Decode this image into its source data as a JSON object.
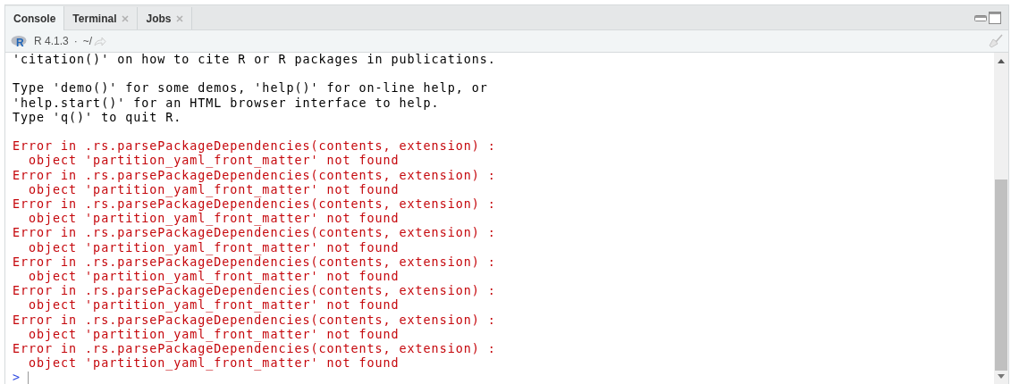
{
  "tabs": [
    {
      "label": "Console",
      "selected": true,
      "closable": false
    },
    {
      "label": "Terminal",
      "selected": false,
      "closable": true
    },
    {
      "label": "Jobs",
      "selected": false,
      "closable": true
    }
  ],
  "toolbar": {
    "logo": "R",
    "version": "R 4.1.3",
    "separator": "·",
    "path": "~/"
  },
  "console": {
    "lines": [
      {
        "kind": "output",
        "text": "'citation()' on how to cite R or R packages in publications."
      },
      {
        "kind": "blank"
      },
      {
        "kind": "output",
        "text": "Type 'demo()' for some demos, 'help()' for on-line help, or"
      },
      {
        "kind": "output",
        "text": "'help.start()' for an HTML browser interface to help."
      },
      {
        "kind": "output",
        "text": "Type 'q()' to quit R."
      },
      {
        "kind": "blank"
      },
      {
        "kind": "error",
        "text": "Error in .rs.parsePackageDependencies(contents, extension) :"
      },
      {
        "kind": "error",
        "text": "  object 'partition_yaml_front_matter' not found"
      },
      {
        "kind": "error",
        "text": "Error in .rs.parsePackageDependencies(contents, extension) :"
      },
      {
        "kind": "error",
        "text": "  object 'partition_yaml_front_matter' not found"
      },
      {
        "kind": "error",
        "text": "Error in .rs.parsePackageDependencies(contents, extension) :"
      },
      {
        "kind": "error",
        "text": "  object 'partition_yaml_front_matter' not found"
      },
      {
        "kind": "error",
        "text": "Error in .rs.parsePackageDependencies(contents, extension) :"
      },
      {
        "kind": "error",
        "text": "  object 'partition_yaml_front_matter' not found"
      },
      {
        "kind": "error",
        "text": "Error in .rs.parsePackageDependencies(contents, extension) :"
      },
      {
        "kind": "error",
        "text": "  object 'partition_yaml_front_matter' not found"
      },
      {
        "kind": "error",
        "text": "Error in .rs.parsePackageDependencies(contents, extension) :"
      },
      {
        "kind": "error",
        "text": "  object 'partition_yaml_front_matter' not found"
      },
      {
        "kind": "error",
        "text": "Error in .rs.parsePackageDependencies(contents, extension) :"
      },
      {
        "kind": "error",
        "text": "  object 'partition_yaml_front_matter' not found"
      },
      {
        "kind": "error",
        "text": "Error in .rs.parsePackageDependencies(contents, extension) :"
      },
      {
        "kind": "error",
        "text": "  object 'partition_yaml_front_matter' not found"
      }
    ],
    "prompt": ">"
  }
}
